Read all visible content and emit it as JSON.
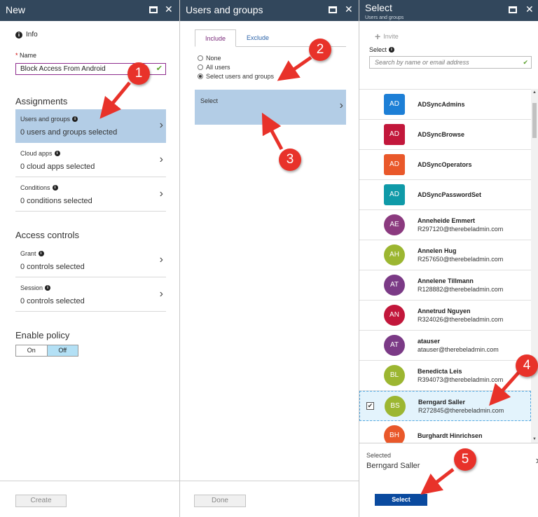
{
  "blade_new": {
    "title": "New",
    "info_label": "Info",
    "name_label": "Name",
    "name_value": "Block Access From Android",
    "assignments_heading": "Assignments",
    "items": [
      {
        "label": "Users and groups",
        "value": "0 users and groups selected"
      },
      {
        "label": "Cloud apps",
        "value": "0 cloud apps selected"
      },
      {
        "label": "Conditions",
        "value": "0 conditions selected"
      }
    ],
    "access_heading": "Access controls",
    "access_items": [
      {
        "label": "Grant",
        "value": "0 controls selected"
      },
      {
        "label": "Session",
        "value": "0 controls selected"
      }
    ],
    "enable_heading": "Enable policy",
    "toggle_on": "On",
    "toggle_off": "Off",
    "create_button": "Create"
  },
  "blade_users": {
    "title": "Users and groups",
    "tabs": [
      "Include",
      "Exclude"
    ],
    "radios": [
      "None",
      "All users",
      "Select users and groups"
    ],
    "select_label": "Select",
    "done_button": "Done"
  },
  "blade_select": {
    "title": "Select",
    "subtitle": "Users and groups",
    "invite_label": "Invite",
    "select_label": "Select",
    "search_placeholder": "Search by name or email address",
    "items": [
      {
        "initials": "AD",
        "name": "ADSyncAdmins",
        "email": "",
        "color": "#1d7fd6"
      },
      {
        "initials": "AD",
        "name": "ADSyncBrowse",
        "email": "",
        "color": "#c2173b"
      },
      {
        "initials": "AD",
        "name": "ADSyncOperators",
        "email": "",
        "color": "#e9582a"
      },
      {
        "initials": "AD",
        "name": "ADSyncPasswordSet",
        "email": "",
        "color": "#0f9aa8"
      },
      {
        "initials": "AE",
        "name": "Anneheide Emmert",
        "email": "R297120@therebeladmin.com",
        "color": "#8b3a7f"
      },
      {
        "initials": "AH",
        "name": "Annelen Hug",
        "email": "R257650@therebeladmin.com",
        "color": "#9cb631"
      },
      {
        "initials": "AT",
        "name": "Annelene Tillmann",
        "email": "R128882@therebeladmin.com",
        "color": "#7b3a86"
      },
      {
        "initials": "AN",
        "name": "Annetrud Nguyen",
        "email": "R324026@therebeladmin.com",
        "color": "#c2173b"
      },
      {
        "initials": "AT",
        "name": "atauser",
        "email": "atauser@therebeladmin.com",
        "color": "#7b3a86"
      },
      {
        "initials": "BL",
        "name": "Benedicta Leis",
        "email": "R394073@therebeladmin.com",
        "color": "#9cb631"
      },
      {
        "initials": "BS",
        "name": "Berngard Saller",
        "email": "R272845@therebeladmin.com",
        "color": "#9cb631"
      },
      {
        "initials": "BH",
        "name": "Burghardt Hinrichsen",
        "email": "",
        "color": "#e9582a"
      }
    ],
    "selected_heading": "Selected",
    "selected_value": "Berngard Saller",
    "select_button": "Select"
  },
  "annotations": [
    "1",
    "2",
    "3",
    "4",
    "5"
  ],
  "colors": {
    "header_bg": "#32475c",
    "selected_bg": "#b3cde6",
    "primary_button": "#0a4a9f",
    "annotation": "#e8322a"
  }
}
